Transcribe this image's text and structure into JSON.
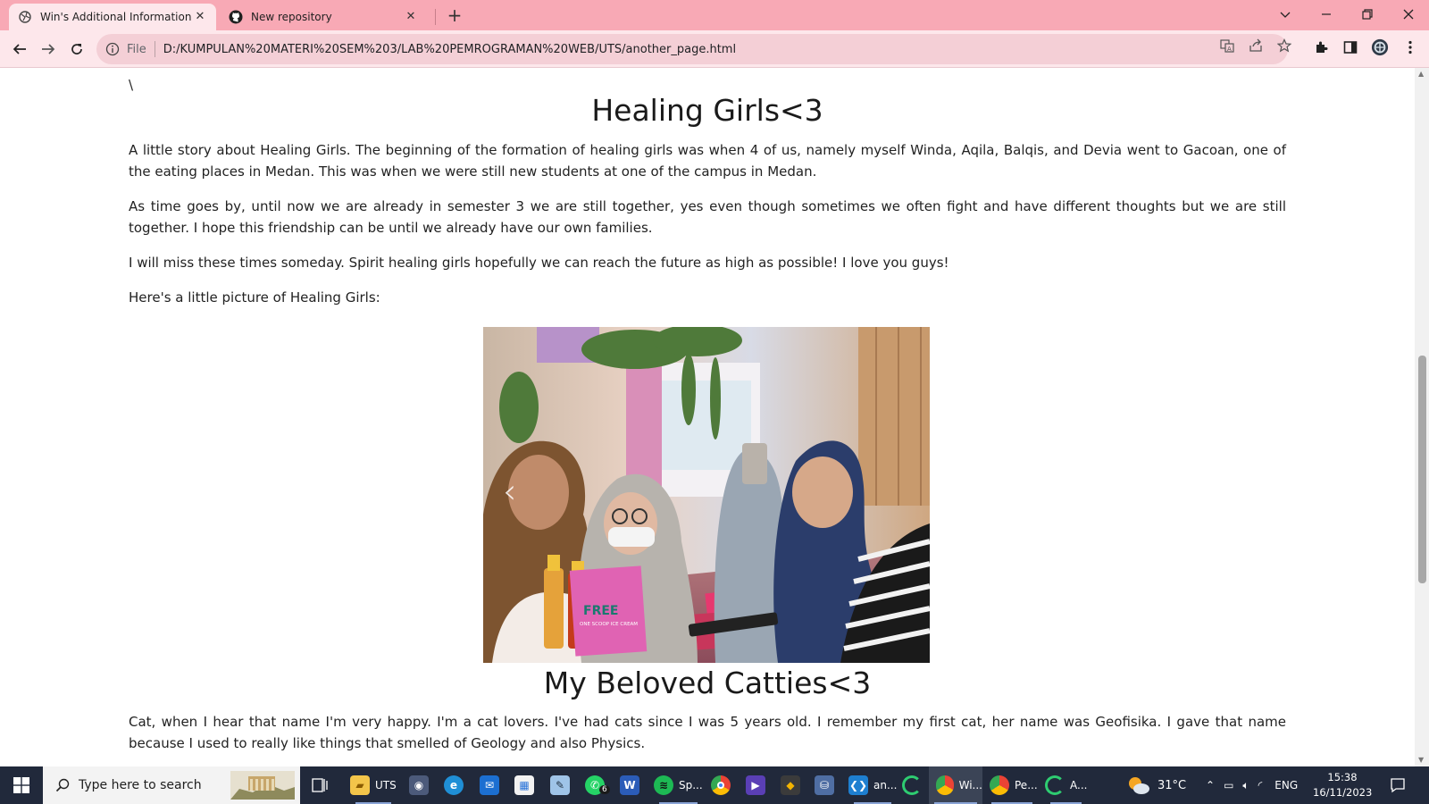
{
  "browser": {
    "tabs": [
      {
        "title": "Win's Additional Information",
        "active": true,
        "favicon": "globe-icon"
      },
      {
        "title": "New repository",
        "active": false,
        "favicon": "github-icon"
      }
    ],
    "new_tab_label": "+",
    "address": {
      "scheme_label": "File",
      "url": "D:/KUMPULAN%20MATERI%20SEM%203/LAB%20PEMROGRAMAN%20WEB/UTS/another_page.html"
    },
    "colors": {
      "tabstrip": "#f8a9b5",
      "toolbar": "#fde7eb",
      "omnibox": "#f4cfd6"
    }
  },
  "page": {
    "stray_char": "\\",
    "section1": {
      "heading": "Healing Girls<3",
      "p1": "A little story about Healing Girls. The beginning of the formation of healing girls was when 4 of us, namely myself Winda, Aqila, Balqis, and Devia went to Gacoan, one of the eating places in Medan. This was when we were still new students at one of the campus in Medan.",
      "p2": "As time goes by, until now we are already in semester 3 we are still together, yes even though sometimes we often fight and have different thoughts but we are still together. I hope this friendship can be until we already have our own families.",
      "p3": "I will miss these times someday. Spirit healing girls hopefully we can reach the future as high as possible! I love you guys!",
      "p4": "Here's a little picture of Healing Girls:",
      "carousel_prev": "‹",
      "photo_sign_text": "FREE",
      "photo_sign_sub": "ONE SCOOP ICE CREAM"
    },
    "section2": {
      "heading": "My Beloved Catties<3",
      "p1": "Cat, when I hear that name I'm very happy. I'm a cat lovers. I've had cats since I was 5 years old. I remember my first cat, her name was Geofisika. I gave that name because I used to really like things that smelled of Geology and also Physics."
    }
  },
  "taskbar": {
    "search_placeholder": "Type here to search",
    "apps": [
      {
        "label": "",
        "icon": "task-view-icon"
      },
      {
        "label": "UTS",
        "icon": "folder-icon"
      },
      {
        "label": "",
        "icon": "camera-icon"
      },
      {
        "label": "",
        "icon": "edge-icon"
      },
      {
        "label": "",
        "icon": "mail-icon"
      },
      {
        "label": "",
        "icon": "store-icon"
      },
      {
        "label": "",
        "icon": "notes-icon"
      },
      {
        "label": "6",
        "icon": "whatsapp-icon"
      },
      {
        "label": "",
        "icon": "word-icon"
      },
      {
        "label": "Sp...",
        "icon": "spotify-icon"
      },
      {
        "label": "",
        "icon": "chrome-icon"
      },
      {
        "label": "",
        "icon": "video-icon"
      },
      {
        "label": "",
        "icon": "git-icon"
      },
      {
        "label": "",
        "icon": "db-icon"
      },
      {
        "label": "an...",
        "icon": "vscode-icon"
      },
      {
        "label": "",
        "icon": "loading-icon"
      },
      {
        "label": "Wi...",
        "icon": "chrome-profile-icon"
      },
      {
        "label": "Pe...",
        "icon": "chrome-profile2-icon"
      },
      {
        "label": "A...",
        "icon": "loading2-icon"
      }
    ],
    "weather": "31°C",
    "lang": "ENG",
    "time": "15:38",
    "date": "16/11/2023"
  }
}
